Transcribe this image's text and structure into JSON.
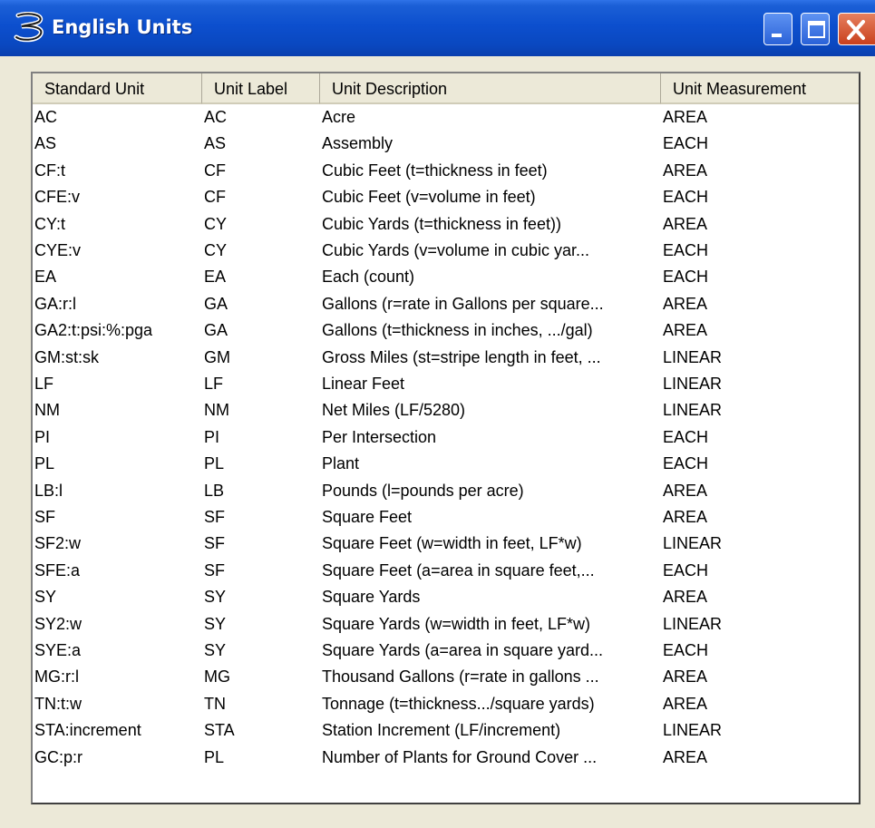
{
  "window": {
    "title": "English Units",
    "app_icon": "bentley-b-logo-icon",
    "buttons": {
      "minimize": "minimize-icon",
      "maximize": "maximize-icon",
      "close": "close-icon"
    }
  },
  "list": {
    "columns": [
      "Standard Unit",
      "Unit Label",
      "Unit Description",
      "Unit Measurement"
    ],
    "rows": [
      [
        "AC",
        "AC",
        "Acre",
        "AREA"
      ],
      [
        "AS",
        "AS",
        "Assembly",
        "EACH"
      ],
      [
        "CF:t",
        "CF",
        "Cubic Feet (t=thickness in feet)",
        "AREA"
      ],
      [
        "CFE:v",
        "CF",
        "Cubic Feet (v=volume in feet)",
        "EACH"
      ],
      [
        "CY:t",
        "CY",
        "Cubic Yards (t=thickness in feet))",
        "AREA"
      ],
      [
        "CYE:v",
        "CY",
        "Cubic Yards (v=volume in cubic yar...",
        "EACH"
      ],
      [
        "EA",
        "EA",
        "Each (count)",
        "EACH"
      ],
      [
        "GA:r:l",
        "GA",
        "Gallons (r=rate in Gallons per square...",
        "AREA"
      ],
      [
        "GA2:t:psi:%:pga",
        "GA",
        "Gallons (t=thickness in inches, .../gal)",
        "AREA"
      ],
      [
        "GM:st:sk",
        "GM",
        "Gross Miles (st=stripe length in feet, ...",
        "LINEAR"
      ],
      [
        "LF",
        "LF",
        "Linear Feet",
        "LINEAR"
      ],
      [
        "NM",
        "NM",
        "Net Miles (LF/5280)",
        "LINEAR"
      ],
      [
        "PI",
        "PI",
        "Per Intersection",
        "EACH"
      ],
      [
        "PL",
        "PL",
        "Plant",
        "EACH"
      ],
      [
        "LB:l",
        "LB",
        "Pounds (l=pounds per acre)",
        "AREA"
      ],
      [
        "SF",
        "SF",
        "Square Feet",
        "AREA"
      ],
      [
        "SF2:w",
        "SF",
        "Square Feet (w=width in feet, LF*w)",
        "LINEAR"
      ],
      [
        "SFE:a",
        "SF",
        "Square Feet (a=area in square feet,...",
        "EACH"
      ],
      [
        "SY",
        "SY",
        "Square Yards",
        "AREA"
      ],
      [
        "SY2:w",
        "SY",
        "Square Yards (w=width in feet, LF*w)",
        "LINEAR"
      ],
      [
        "SYE:a",
        "SY",
        "Square Yards (a=area in square yard...",
        "EACH"
      ],
      [
        "MG:r:l",
        "MG",
        "Thousand Gallons (r=rate in gallons ...",
        "AREA"
      ],
      [
        "TN:t:w",
        "TN",
        "Tonnage (t=thickness.../square yards)",
        "AREA"
      ],
      [
        "STA:increment",
        "STA",
        "Station Increment (LF/increment)",
        "LINEAR"
      ],
      [
        "GC:p:r",
        "PL",
        "Number of Plants for Ground Cover ...",
        "AREA"
      ]
    ]
  }
}
